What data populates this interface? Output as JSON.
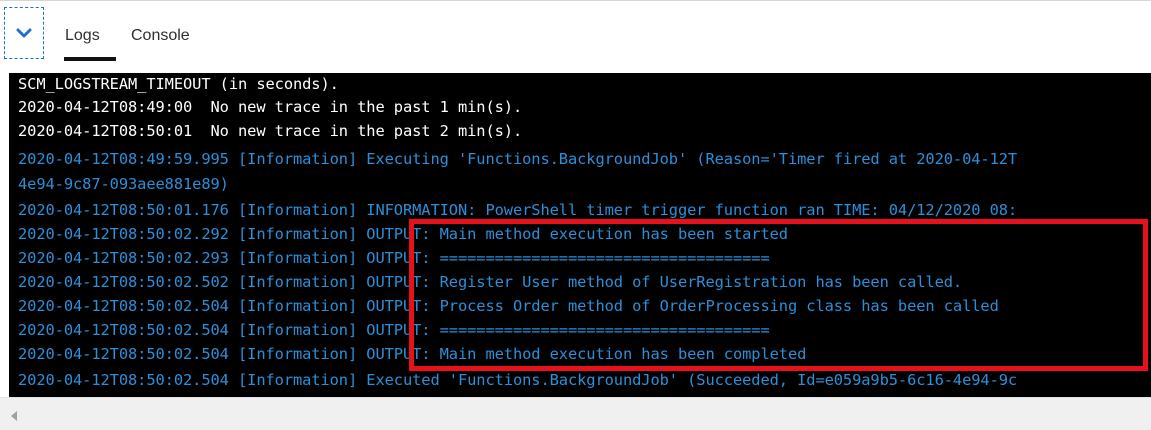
{
  "tabs": [
    {
      "label": "Logs",
      "active": true
    },
    {
      "label": "Console",
      "active": false
    }
  ],
  "icons": {
    "collapse": "chevron-down-icon",
    "scroll_left": "triangle-left-icon"
  },
  "colors": {
    "accent": "#1f6fd1",
    "console_bg": "#000000",
    "log_white": "#ffffff",
    "log_blue": "#2b8fd9",
    "highlight": "#e8101b"
  },
  "log_lines": [
    {
      "text": "SCM_LOGSTREAM_TIMEOUT (in seconds).",
      "color": "white"
    },
    {
      "text": "2020-04-12T08:49:00  No new trace in the past 1 min(s).",
      "color": "white"
    },
    {
      "text": "2020-04-12T08:50:01  No new trace in the past 2 min(s).",
      "color": "white"
    },
    {
      "text": "2020-04-12T08:49:59.995 [Information] Executing 'Functions.BackgroundJob' (Reason='Timer fired at 2020-04-12T",
      "color": "blue"
    },
    {
      "text": "4e94-9c87-093aee881e89)",
      "color": "blue"
    },
    {
      "text": "2020-04-12T08:50:01.176 [Information] INFORMATION: PowerShell timer trigger function ran TIME: 04/12/2020 08:",
      "color": "blue"
    },
    {
      "text": "2020-04-12T08:50:02.292 [Information] OUTPUT: Main method execution has been started",
      "color": "blue"
    },
    {
      "text": "2020-04-12T08:50:02.293 [Information] OUTPUT: ====================================",
      "color": "blue"
    },
    {
      "text": "2020-04-12T08:50:02.502 [Information] OUTPUT: Register User method of UserRegistration has been called.",
      "color": "blue"
    },
    {
      "text": "2020-04-12T08:50:02.504 [Information] OUTPUT: Process Order method of OrderProcessing class has been called",
      "color": "blue"
    },
    {
      "text": "2020-04-12T08:50:02.504 [Information] OUTPUT: ====================================",
      "color": "blue"
    },
    {
      "text": "2020-04-12T08:50:02.504 [Information] OUTPUT: Main method execution has been completed",
      "color": "blue"
    },
    {
      "text": "2020-04-12T08:50:02.504 [Information] Executed 'Functions.BackgroundJob' (Succeeded, Id=e059a9b5-6c16-4e94-9c",
      "color": "blue"
    }
  ]
}
